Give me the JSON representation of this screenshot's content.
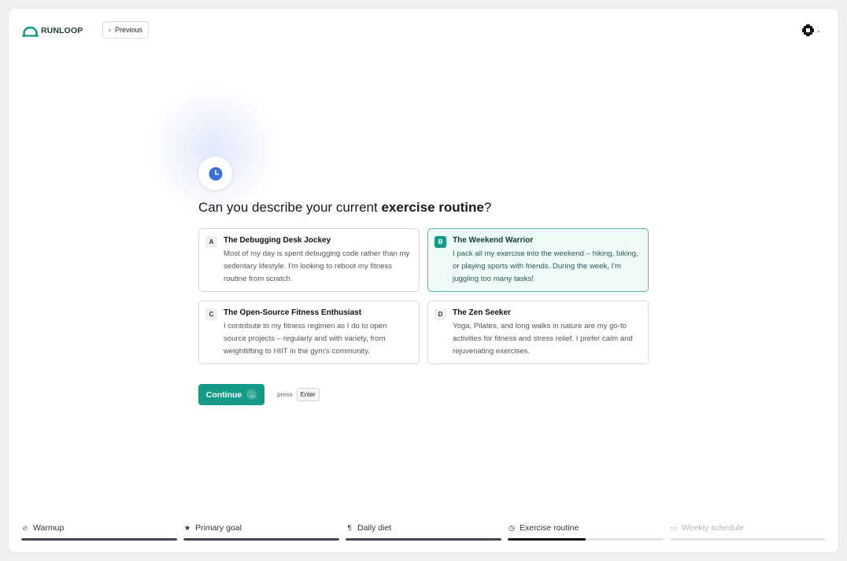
{
  "header": {
    "logo_text": "RUNLOOP",
    "previous_label": "Previous"
  },
  "question": {
    "prefix": "Can you describe your current ",
    "emphasis": "exercise routine",
    "suffix": "?"
  },
  "options": [
    {
      "key": "A",
      "title": "The Debugging Desk Jockey",
      "description": "Most of my day is spent debugging code rather than my sedentary lifestyle. I'm looking to reboot my fitness routine from scratch.",
      "selected": false
    },
    {
      "key": "B",
      "title": "The Weekend Warrior",
      "description": "I pack all my exercise into the weekend – hiking, biking, or playing sports with friends. During the week, I'm juggling too many tasks!",
      "selected": true
    },
    {
      "key": "C",
      "title": "The Open-Source Fitness Enthusiast",
      "description": "I contribute to my fitness regimen as I do to open source projects – regularly and with variety, from weightlifting to HIIT in the gym's community.",
      "selected": false
    },
    {
      "key": "D",
      "title": "The Zen Seeker",
      "description": "Yoga, Pilates, and long walks in nature are my go-to activities for fitness and stress relief. I prefer calm and rejuvenating exercises.",
      "selected": false
    }
  ],
  "actions": {
    "continue_label": "Continue",
    "press_label": "press",
    "key_hint": "Enter"
  },
  "steps": [
    {
      "label": "Warmup",
      "icon": "flame-icon",
      "progress": 1.0,
      "state": "done"
    },
    {
      "label": "Primary goal",
      "icon": "star-icon",
      "progress": 1.0,
      "state": "done"
    },
    {
      "label": "Daily diet",
      "icon": "utensils-icon",
      "progress": 1.0,
      "state": "done"
    },
    {
      "label": "Exercise routine",
      "icon": "clock-icon",
      "progress": 0.5,
      "state": "active"
    },
    {
      "label": "Weekly schedule",
      "icon": "calendar-icon",
      "progress": 0.0,
      "state": "pending"
    }
  ],
  "colors": {
    "accent": "#149a85",
    "selected_bg": "#edfaf7",
    "question_icon": "#3b6fe0"
  }
}
